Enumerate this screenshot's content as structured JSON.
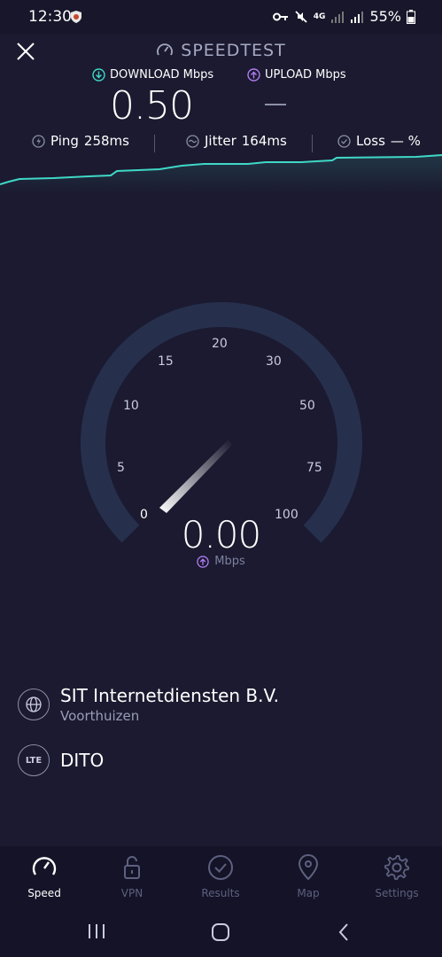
{
  "status_bar": {
    "time": "12:30",
    "network": "4G",
    "battery": "55%"
  },
  "header": {
    "title": "SPEEDTEST",
    "download_label": "DOWNLOAD Mbps",
    "upload_label": "UPLOAD Mbps",
    "download_value": "0.50",
    "upload_value": "—"
  },
  "stats": {
    "ping": "Ping",
    "ping_value": "258ms",
    "jitter": "Jitter",
    "jitter_value": "164ms",
    "loss": "Loss",
    "loss_value": "— %"
  },
  "gauge": {
    "labels": [
      "0",
      "5",
      "10",
      "15",
      "20",
      "30",
      "50",
      "75",
      "100"
    ],
    "value": "0.00",
    "unit": "Mbps",
    "needle_value": 0.5
  },
  "server": {
    "provider": "SIT Internetdiensten B.V.",
    "location": "Voorthuizen",
    "badge": "LTE",
    "carrier": "DITO"
  },
  "nav": {
    "items": [
      "Speed",
      "VPN",
      "Results",
      "Map",
      "Settings"
    ]
  },
  "colors": {
    "download": "#3fd8c6",
    "upload": "#b07cf0",
    "background": "#1b1a30",
    "gauge_track": "#26304d"
  }
}
